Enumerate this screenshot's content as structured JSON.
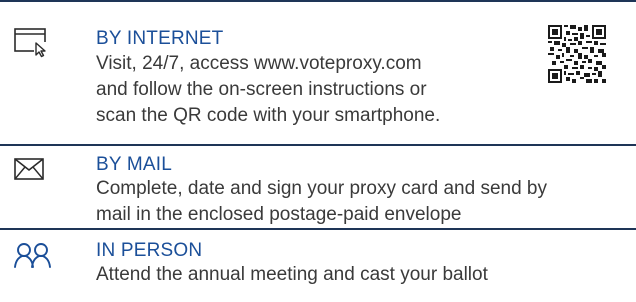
{
  "sections": [
    {
      "heading": "BY INTERNET",
      "lines": [
        "Visit, 24/7, access www.voteproxy.com",
        "and follow the on-screen instructions or",
        "scan the QR code with your smartphone."
      ],
      "icon": "browser-cursor-icon"
    },
    {
      "heading": "BY MAIL",
      "lines": [
        "Complete, date and sign your proxy card and send by",
        "mail in the enclosed postage-paid envelope"
      ],
      "icon": "envelope-icon"
    },
    {
      "heading": "IN PERSON",
      "lines": [
        "Attend the annual meeting and cast your ballot"
      ],
      "icon": "people-icon"
    }
  ],
  "qr_code": {
    "icon": "qr-code-icon"
  },
  "colors": {
    "heading": "#1b4f99",
    "text": "#3a3a3a",
    "rule": "#1e3557",
    "icon": "#2b2b2b"
  }
}
